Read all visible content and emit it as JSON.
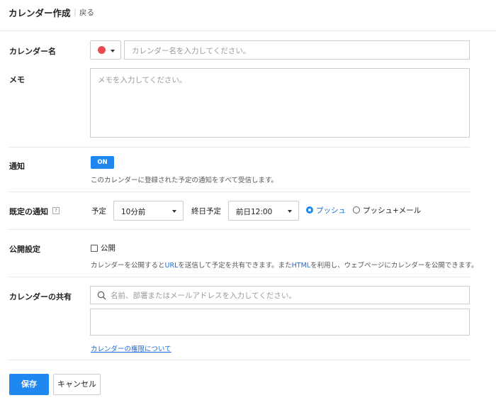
{
  "colors": {
    "accent": "#1e88f0",
    "calendar_color": "#ec4b4b",
    "link": "#1a6dd8"
  },
  "header": {
    "title": "カレンダー作成",
    "separator": "|",
    "back_label": "戻る"
  },
  "form": {
    "name": {
      "label": "カレンダー名",
      "placeholder": "カレンダー名を入力してください。",
      "color_icon": "circle-icon"
    },
    "memo": {
      "label": "メモ",
      "placeholder": "メモを入力してください。"
    },
    "notification": {
      "label": "通知",
      "toggle_label": "ON",
      "toggle_on": true,
      "description": "このカレンダーに登録された予定の通知をすべて受信します。"
    },
    "default_notification": {
      "label": "既定の通知",
      "help_label": "?",
      "schedule_label": "予定",
      "schedule_value": "10分前",
      "allday_label": "終日予定",
      "allday_value": "前日12:00",
      "options": [
        {
          "label": "プッシュ",
          "selected": true
        },
        {
          "label": "プッシュ+メール",
          "selected": false
        }
      ]
    },
    "publish": {
      "label": "公開設定",
      "checkbox_label": "公開",
      "checked": false,
      "desc_part1": "カレンダーを公開すると",
      "desc_url": "URL",
      "desc_part2": "を送信して予定を共有できます。また",
      "desc_html": "HTML",
      "desc_part3": "を利用し、ウェブページにカレンダーを公開できます。"
    },
    "share": {
      "label": "カレンダーの共有",
      "placeholder": "名前、部署またはメールアドレスを入力してください。",
      "permissions_link": "カレンダーの権限について",
      "search_icon": "search-icon"
    }
  },
  "footer": {
    "save_label": "保存",
    "cancel_label": "キャンセル"
  }
}
